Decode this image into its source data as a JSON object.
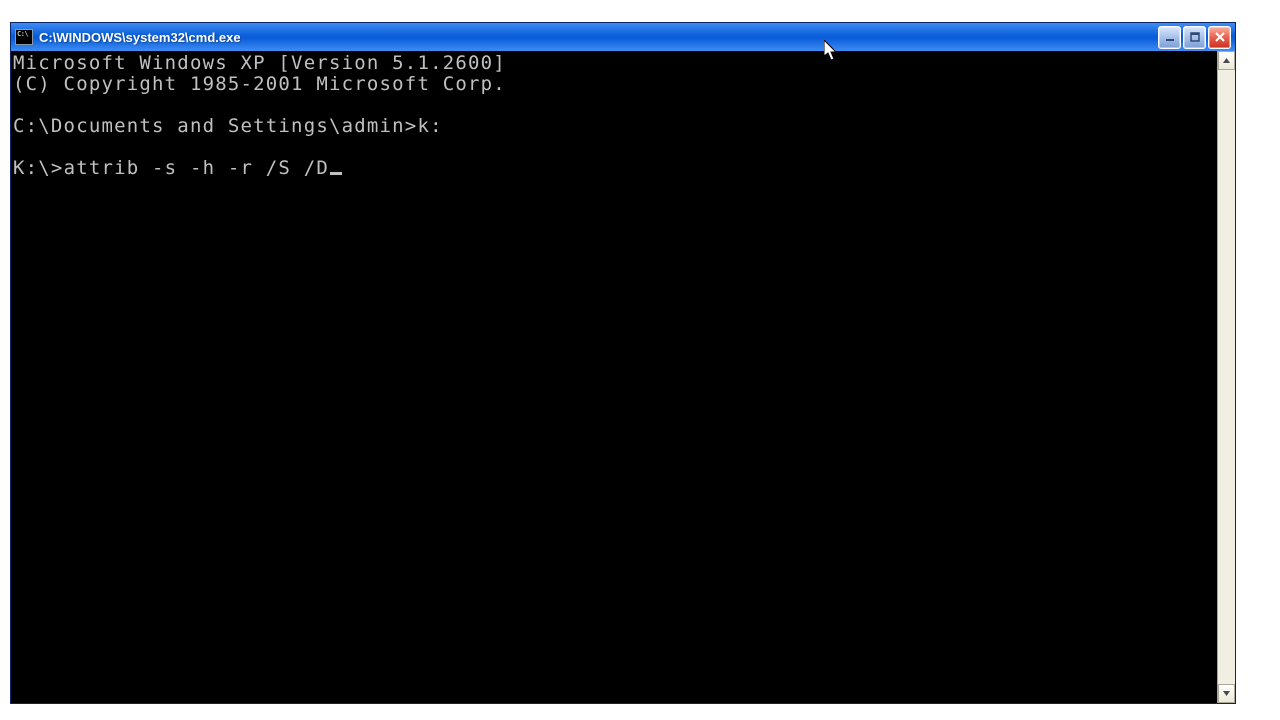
{
  "window": {
    "title": "C:\\WINDOWS\\system32\\cmd.exe",
    "icon_label": "C:\\"
  },
  "terminal": {
    "lines": [
      "Microsoft Windows XP [Version 5.1.2600]",
      "(C) Copyright 1985-2001 Microsoft Corp.",
      "",
      "C:\\Documents and Settings\\admin>k:",
      ""
    ],
    "active_prompt": "K:\\>",
    "active_input": "attrib -s -h -r /S /D"
  }
}
